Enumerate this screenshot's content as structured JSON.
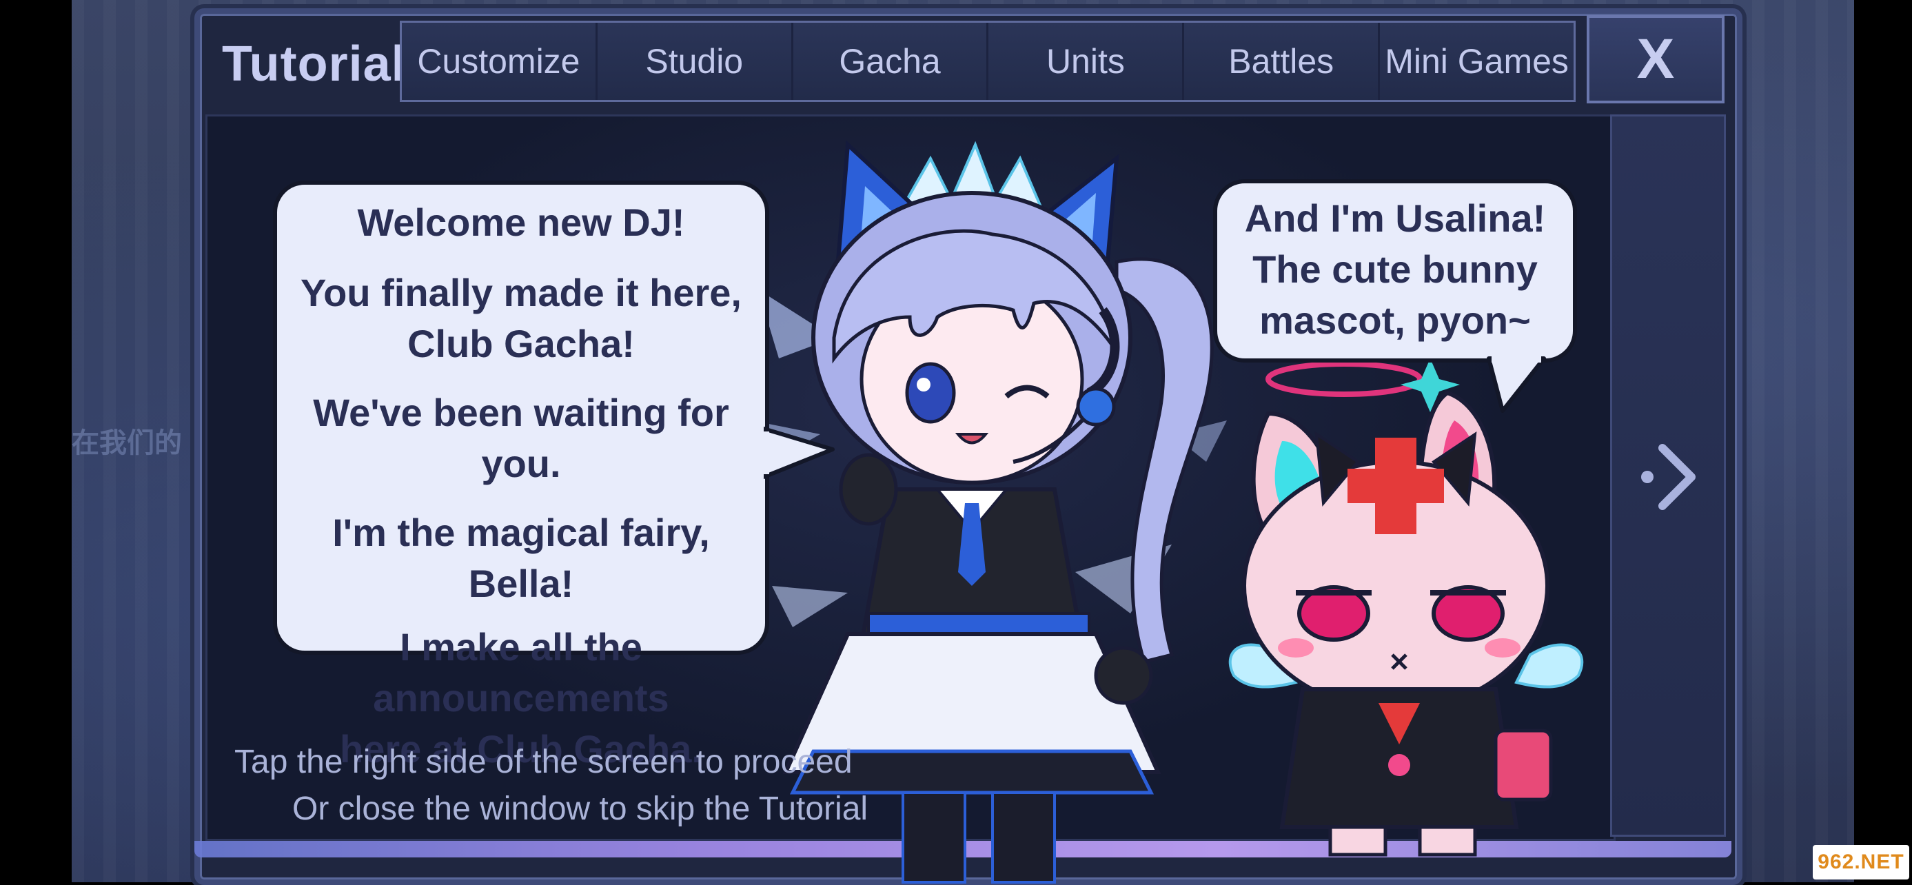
{
  "background": {
    "sign_text": "在我们的"
  },
  "header": {
    "title": "Tutorial",
    "tabs": [
      {
        "label": "Customize"
      },
      {
        "label": "Studio"
      },
      {
        "label": "Gacha"
      },
      {
        "label": "Units"
      },
      {
        "label": "Battles"
      },
      {
        "label": "Mini Games"
      }
    ],
    "close_label": "X"
  },
  "dialogue": {
    "bella": {
      "lines": [
        "Welcome new DJ!",
        "You finally made it here,",
        "Club Gacha!",
        "We've been waiting for you.",
        "I'm the magical fairy, Bella!",
        "I make all the announcements",
        "here at Club Gacha."
      ]
    },
    "usalina": {
      "lines": [
        "And I'm Usalina!",
        "The cute bunny",
        "mascot, pyon~"
      ]
    }
  },
  "hints": {
    "line1": "Tap the right side of the screen to proceed",
    "line2": "Or close the window to skip the Tutorial"
  },
  "watermark": "962.NET",
  "colors": {
    "panel_bg": "#1f2640",
    "tab_text": "#c3c9ec",
    "bubble_bg": "#e8ecfb",
    "bubble_text": "#2a2f55",
    "accent_purple": "#a68ef0"
  },
  "icons": {
    "next": "chevron-right-icon",
    "close": "close-icon"
  }
}
